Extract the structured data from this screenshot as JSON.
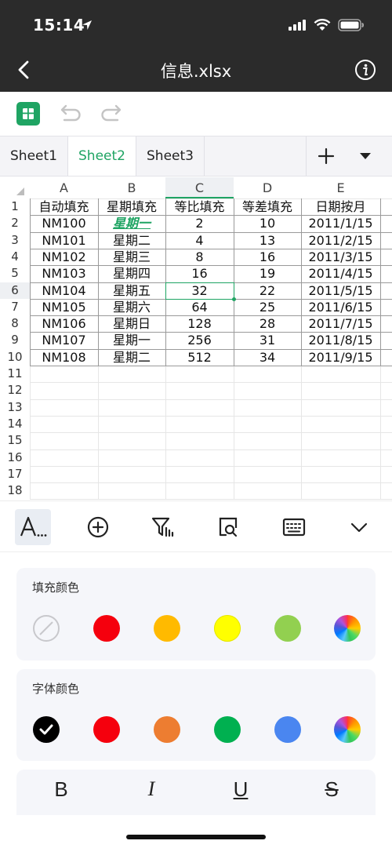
{
  "status": {
    "time": "15:14"
  },
  "nav": {
    "title": "信息.xlsx"
  },
  "tabs": [
    "Sheet1",
    "Sheet2",
    "Sheet3"
  ],
  "active_tab": "Sheet2",
  "columns": [
    "A",
    "B",
    "C",
    "D",
    "E"
  ],
  "selected_column": "C",
  "rows": [
    "1",
    "2",
    "3",
    "4",
    "5",
    "6",
    "7",
    "8",
    "9",
    "10",
    "11",
    "12",
    "13",
    "14",
    "15",
    "16",
    "17",
    "18"
  ],
  "selected_row": "6",
  "header_row": [
    "自动填充",
    "星期填充",
    "等比填充",
    "等差填充",
    "日期按月"
  ],
  "data_rows": [
    [
      "NM100",
      "星期一",
      "2",
      "10",
      "2011/1/15"
    ],
    [
      "NM101",
      "星期二",
      "4",
      "13",
      "2011/2/15"
    ],
    [
      "NM102",
      "星期三",
      "8",
      "16",
      "2011/3/15"
    ],
    [
      "NM103",
      "星期四",
      "16",
      "19",
      "2011/4/15"
    ],
    [
      "NM104",
      "星期五",
      "32",
      "22",
      "2011/5/15"
    ],
    [
      "NM105",
      "星期六",
      "64",
      "25",
      "2011/6/15"
    ],
    [
      "NM106",
      "星期日",
      "128",
      "28",
      "2011/7/15"
    ],
    [
      "NM107",
      "星期一",
      "256",
      "31",
      "2011/8/15"
    ],
    [
      "NM108",
      "星期二",
      "512",
      "34",
      "2011/9/15"
    ]
  ],
  "fill_color": {
    "label": "填充颜色",
    "swatches": [
      {
        "name": "none",
        "color": "none"
      },
      {
        "name": "red",
        "color": "#f5000d"
      },
      {
        "name": "orange",
        "color": "#ffba00"
      },
      {
        "name": "yellow",
        "color": "#ffff00"
      },
      {
        "name": "green",
        "color": "#92d050"
      },
      {
        "name": "custom",
        "color": "wheel"
      }
    ]
  },
  "font_color": {
    "label": "字体颜色",
    "swatches": [
      {
        "name": "black",
        "color": "#000000",
        "selected": true
      },
      {
        "name": "red",
        "color": "#f5000d"
      },
      {
        "name": "orange",
        "color": "#ed7d31"
      },
      {
        "name": "green",
        "color": "#00b050"
      },
      {
        "name": "blue",
        "color": "#4a86f0"
      },
      {
        "name": "custom",
        "color": "wheel"
      }
    ]
  },
  "format": {
    "bold": "B",
    "italic": "I",
    "underline": "U",
    "strike": "S"
  },
  "accent": "#1fa463"
}
